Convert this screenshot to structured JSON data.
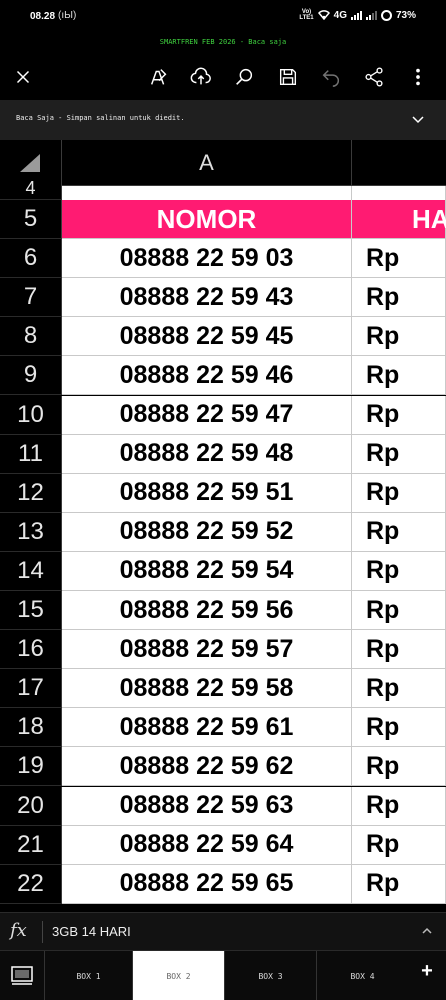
{
  "status": {
    "time": "08.28",
    "volte_top": "Vo)",
    "volte_bottom": "LTE1",
    "network": "4G",
    "battery": "73%"
  },
  "document": {
    "title": "SMARTFREN FEB 2026 - Baca saja"
  },
  "toolbar": {
    "icons": [
      "close-icon",
      "pen-edit-icon",
      "cloud-upload-icon",
      "search-icon",
      "save-icon",
      "undo-icon",
      "share-icon",
      "more-vertical-icon"
    ]
  },
  "banner": {
    "text": "Baca Saja - Simpan salinan untuk diedit."
  },
  "sheet": {
    "column_a": "A",
    "partial_row_label": "4",
    "header_row": {
      "row": "5",
      "col_a": "NOMOR",
      "col_b": "HA"
    },
    "rows": [
      {
        "row": "6",
        "number": "08888 22 59 03",
        "price": "Rp"
      },
      {
        "row": "7",
        "number": "08888 22 59 43",
        "price": "Rp"
      },
      {
        "row": "8",
        "number": "08888 22 59 45",
        "price": "Rp"
      },
      {
        "row": "9",
        "number": "08888 22 59 46",
        "price": "Rp"
      },
      {
        "row": "10",
        "number": "08888 22 59 47",
        "price": "Rp"
      },
      {
        "row": "11",
        "number": "08888 22 59 48",
        "price": "Rp"
      },
      {
        "row": "12",
        "number": "08888 22 59 51",
        "price": "Rp"
      },
      {
        "row": "13",
        "number": "08888 22 59 52",
        "price": "Rp"
      },
      {
        "row": "14",
        "number": "08888 22 59 54",
        "price": "Rp"
      },
      {
        "row": "15",
        "number": "08888 22 59 56",
        "price": "Rp"
      },
      {
        "row": "16",
        "number": "08888 22 59 57",
        "price": "Rp"
      },
      {
        "row": "17",
        "number": "08888 22 59 58",
        "price": "Rp"
      },
      {
        "row": "18",
        "number": "08888 22 59 61",
        "price": "Rp"
      },
      {
        "row": "19",
        "number": "08888 22 59 62",
        "price": "Rp"
      },
      {
        "row": "20",
        "number": "08888 22 59 63",
        "price": "Rp"
      },
      {
        "row": "21",
        "number": "08888 22 59 64",
        "price": "Rp"
      },
      {
        "row": "22",
        "number": "08888 22 59 65",
        "price": "Rp"
      }
    ],
    "colors": {
      "header_bg": "#ff1b72",
      "header_text": "#ffffff"
    }
  },
  "formula_bar": {
    "fx": "fx",
    "value": "3GB 14 HARI"
  },
  "sheet_tabs": {
    "tabs": [
      "BOX 1",
      "BOX 2",
      "BOX 3",
      "BOX 4"
    ],
    "active_index": 1,
    "add_label": "+"
  }
}
